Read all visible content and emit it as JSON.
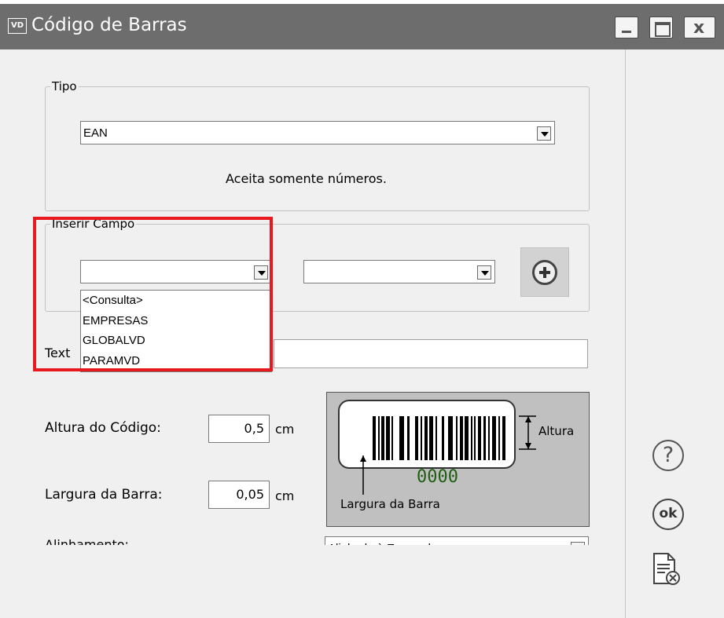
{
  "window": {
    "icon_text": "VD",
    "title": "Código de Barras"
  },
  "tipo": {
    "legend": "Tipo",
    "selected": "EAN",
    "hint": "Aceita somente números."
  },
  "inserir_campo": {
    "legend": "Inserir Campo",
    "combo1_value": "",
    "combo2_value": "",
    "dropdown_options": [
      "<Consulta>",
      "EMPRESAS",
      "GLOBALVD",
      "PARAMVD"
    ]
  },
  "texto": {
    "label": "Text"
  },
  "altura": {
    "label": "Altura do Código:",
    "value": "0,5",
    "unit": "cm"
  },
  "largura": {
    "label": "Largura da Barra:",
    "value": "0,05",
    "unit": "cm"
  },
  "preview": {
    "digits": "0000",
    "altura_caption": "Altura",
    "largura_caption": "Largura da Barra"
  },
  "alinhamento": {
    "label": "Alinhamento:",
    "value": "Alinhado à Esquerda"
  },
  "icons": {
    "help": "help-icon",
    "ok": "ok-icon",
    "cancel": "cancel-report-icon",
    "add": "plus-circle-icon"
  },
  "colors": {
    "titlebar": "#6d6d6d",
    "highlight": "#e8181f",
    "digits": "#1d5e10"
  }
}
